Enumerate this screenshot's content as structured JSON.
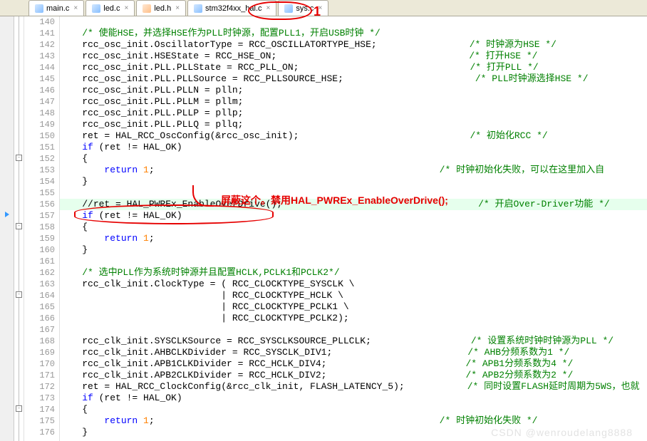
{
  "tabs": [
    {
      "label": "main.c",
      "type": "c"
    },
    {
      "label": "led.c",
      "type": "c"
    },
    {
      "label": "led.h",
      "type": "h"
    },
    {
      "label": "stm32f4xx_hal.c",
      "type": "c"
    },
    {
      "label": "sys.c",
      "type": "c",
      "active": true
    }
  ],
  "annotation1": "1",
  "annotation2_text": "屏蔽这个。禁用HAL_PWREx_EnableOverDrive();",
  "watermark": "CSDN @wenroudelang8888",
  "code": {
    "l140": "",
    "l141_c": "    /* 使能HSE，并选择HSE作为PLL时钟源，配置PLL1，开启USB时钟 */",
    "l142a": "    rcc_osc_init.OscillatorType = RCC_OSCILLATORTYPE_HSE;",
    "l142c": "/* 时钟源为HSE */",
    "l143a": "    rcc_osc_init.HSEState = RCC_HSE_ON;",
    "l143c": "/* 打开HSE */",
    "l144a": "    rcc_osc_init.PLL.PLLState = RCC_PLL_ON;",
    "l144c": "/* 打开PLL */",
    "l145a": "    rcc_osc_init.PLL.PLLSource = RCC_PLLSOURCE_HSE;",
    "l145c": "/* PLL时钟源选择HSE */",
    "l146a": "    rcc_osc_init.PLL.PLLN = plln;",
    "l147a": "    rcc_osc_init.PLL.PLLM = pllm;",
    "l148a": "    rcc_osc_init.PLL.PLLP = pllp;",
    "l149a": "    rcc_osc_init.PLL.PLLQ = pllq;",
    "l150a": "    ret = HAL_RCC_OscConfig(&rcc_osc_init);",
    "l150c": "/* 初始化RCC */",
    "l151a": "    ",
    "l151k": "if",
    "l151b": " (ret != HAL_OK)",
    "l152a": "    {",
    "l153a": "        ",
    "l153k": "return",
    "l153b": " ",
    "l153n": "1",
    "l153e": ";",
    "l153c": "/* 时钟初始化失败，可以在这里加入自",
    "l154a": "    }",
    "l155a": "",
    "l156a": "    //",
    "l156b": "ret = HAL_PWREx_EnableOverDrive();",
    "l156c": "/* 开启Over-Driver功能 */",
    "l157a": "    ",
    "l157k": "if",
    "l157b": " (ret != HAL_OK)",
    "l158a": "    {",
    "l159a": "        ",
    "l159k": "return",
    "l159b": " ",
    "l159n": "1",
    "l159e": ";",
    "l160a": "    }",
    "l161a": "",
    "l162c": "    /* 选中PLL作为系统时钟源并且配置HCLK,PCLK1和PCLK2*/",
    "l163a": "    rcc_clk_init.ClockType = ( RCC_CLOCKTYPE_SYSCLK \\",
    "l164a": "                             | RCC_CLOCKTYPE_HCLK \\",
    "l165a": "                             | RCC_CLOCKTYPE_PCLK1 \\",
    "l166a": "                             | RCC_CLOCKTYPE_PCLK2);",
    "l167a": "",
    "l168a": "    rcc_clk_init.SYSCLKSource = RCC_SYSCLKSOURCE_PLLCLK;",
    "l168c": "/* 设置系统时钟时钟源为PLL */",
    "l169a": "    rcc_clk_init.AHBCLKDivider = RCC_SYSCLK_DIV1;",
    "l169c": "/* AHB分频系数为1 */",
    "l170a": "    rcc_clk_init.APB1CLKDivider = RCC_HCLK_DIV4;",
    "l170c": "/* APB1分频系数为4 */",
    "l171a": "    rcc_clk_init.APB2CLKDivider = RCC_HCLK_DIV2;",
    "l171c": "/* APB2分频系数为2 */",
    "l172a": "    ret = HAL_RCC_ClockConfig(&rcc_clk_init, FLASH_LATENCY_5);",
    "l172c": "/* 同时设置FLASH延时周期为5WS，也就",
    "l173a": "    ",
    "l173k": "if",
    "l173b": " (ret != HAL_OK)",
    "l174a": "    {",
    "l175a": "        ",
    "l175k": "return",
    "l175b": " ",
    "l175n": "1",
    "l175e": ";",
    "l175c": "/* 时钟初始化失败 */",
    "l176a": "    }"
  },
  "line_numbers": [
    "140",
    "141",
    "142",
    "143",
    "144",
    "145",
    "146",
    "147",
    "148",
    "149",
    "150",
    "151",
    "152",
    "153",
    "154",
    "155",
    "156",
    "157",
    "158",
    "159",
    "160",
    "161",
    "162",
    "163",
    "164",
    "165",
    "166",
    "167",
    "168",
    "169",
    "170",
    "171",
    "172",
    "173",
    "174",
    "175",
    "176"
  ]
}
